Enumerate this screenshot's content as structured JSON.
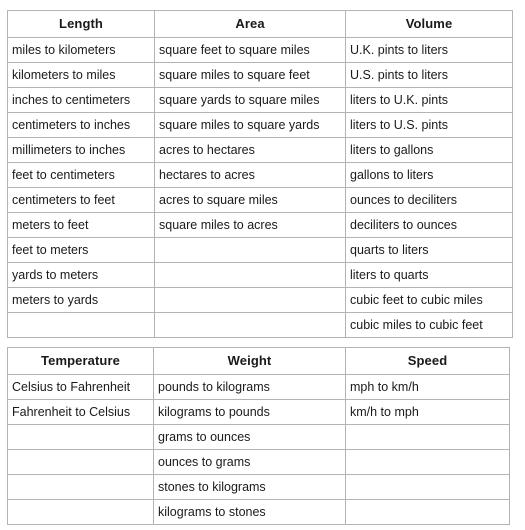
{
  "tables": [
    {
      "name": "measurement-conversions-primary",
      "headers": [
        "Length",
        "Area",
        "Volume"
      ],
      "rows": [
        [
          "miles to kilometers",
          "square feet to square miles",
          "U.K. pints to liters"
        ],
        [
          "kilometers to miles",
          "square miles to square feet",
          "U.S. pints to liters"
        ],
        [
          "inches to centimeters",
          "square yards to square miles",
          "liters to U.K. pints"
        ],
        [
          "centimeters to inches",
          "square miles to square yards",
          "liters to U.S. pints"
        ],
        [
          "millimeters to inches",
          "acres to hectares",
          "liters to gallons"
        ],
        [
          "feet to centimeters",
          "hectares to acres",
          "gallons to liters"
        ],
        [
          "centimeters to feet",
          "acres to square miles",
          "ounces to deciliters"
        ],
        [
          "meters to feet",
          "square miles to acres",
          "deciliters to ounces"
        ],
        [
          "feet to meters",
          "",
          "quarts to liters"
        ],
        [
          "yards to meters",
          "",
          "liters to quarts"
        ],
        [
          "meters to yards",
          "",
          "cubic feet to cubic miles"
        ],
        [
          "",
          "",
          "cubic miles to cubic feet"
        ]
      ]
    },
    {
      "name": "measurement-conversions-secondary",
      "headers": [
        "Temperature",
        "Weight",
        "Speed"
      ],
      "rows": [
        [
          "Celsius to Fahrenheit",
          "pounds to kilograms",
          "mph to km/h"
        ],
        [
          "Fahrenheit to Celsius",
          "kilograms to pounds",
          "km/h to mph"
        ],
        [
          "",
          "grams to ounces",
          ""
        ],
        [
          "",
          "ounces to grams",
          ""
        ],
        [
          "",
          "stones to kilograms",
          ""
        ],
        [
          "",
          "kilograms to stones",
          ""
        ]
      ]
    }
  ],
  "colors": {
    "border": "#b3b3b3",
    "text": "#1a1a1a",
    "background": "#ffffff"
  }
}
